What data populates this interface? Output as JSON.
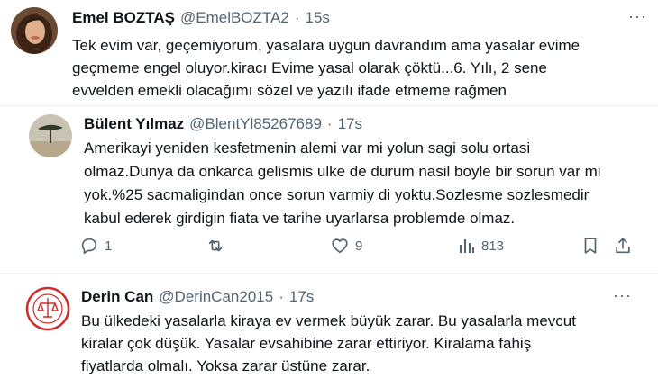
{
  "tweets": [
    {
      "name": "Emel BOZTAŞ",
      "handle": "@EmelBOZTA2",
      "sep": "·",
      "time": "15s",
      "lines": [
        "Tek evim var, geçemiyorum, yasalara uygun davrandım ama yasalar evime",
        "geçmeme engel oluyor.kiracı  Evime yasal olarak çöktü...6. Yılı, 2 sene",
        "evvelden emekli olacağımı sözel ve yazılı ifade etmeme rağmen"
      ]
    },
    {
      "name": "Bülent Yılmaz",
      "handle": "@BlentYl85267689",
      "sep": "·",
      "time": "17s",
      "lines": [
        "Amerikayi yeniden kesfetmenin alemi var mi yolun sagi solu ortasi",
        "olmaz.Dunya da onkarca gelismis ulke de durum nasil boyle bir sorun var mi",
        "yok.%25 sacmaligindan once sorun varmiy di yoktu.Sozlesme sozlesmedir",
        "kabul ederek girdigin fiata ve tarihe uyarlarsa problemde olmaz."
      ],
      "actions": {
        "reply_count": "1",
        "retweet_count": "",
        "like_count": "9",
        "views_count": "813"
      }
    },
    {
      "name": "Derin Can",
      "handle": "@DerinCan2015",
      "sep": "·",
      "time": "17s",
      "lines": [
        "Bu ülkedeki yasalarla kiraya ev vermek büyük zarar. Bu yasalarla mevcut",
        "kiralar çok düşük. Yasalar evsahibine zarar ettiriyor. Kiralama fahiş",
        "fiyatlarda olmalı. Yoksa zarar üstüne zarar."
      ]
    }
  ],
  "more_glyph": "···",
  "colors": {
    "text": "#0f1419",
    "muted": "#536471",
    "divider": "#eff3f4"
  }
}
